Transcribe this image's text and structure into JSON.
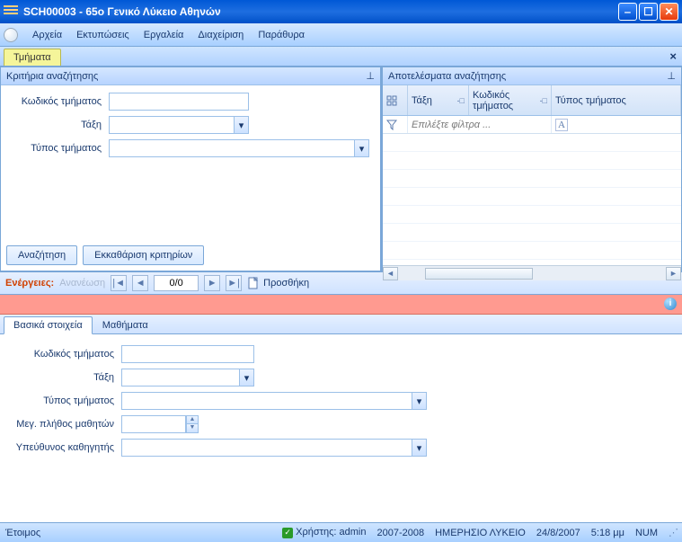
{
  "window": {
    "title": "SCH00003 - 65ο Γενικό Λύκειο Αθηνών"
  },
  "menu": {
    "items": [
      "Αρχεία",
      "Εκτυπώσεις",
      "Εργαλεία",
      "Διαχείριση",
      "Παράθυρα"
    ]
  },
  "main_tab": {
    "label": "Τμήματα"
  },
  "criteria_panel": {
    "title": "Κριτήρια αναζήτησης",
    "fields": {
      "code_label": "Κωδικός τμήματος",
      "class_label": "Τάξη",
      "type_label": "Τύπος τμήματος",
      "code_value": "",
      "class_value": "",
      "type_value": ""
    },
    "search_btn": "Αναζήτηση",
    "clear_btn": "Εκκαθάριση κριτηρίων"
  },
  "results_panel": {
    "title": "Αποτελέσματα αναζήτησης",
    "columns": {
      "col1": "Τάξη",
      "col2": "Κωδικός τμήματος",
      "col3": "Τύπος τμήματος"
    },
    "filter_placeholder": "Επιλέξτε φίλτρα ..."
  },
  "actions": {
    "label": "Ενέργειες:",
    "refresh": "Ανανέωση",
    "pager": "0/0",
    "add": "Προσθήκη"
  },
  "detail_tabs": {
    "basic": "Βασικά στοιχεία",
    "subjects": "Μαθήματα"
  },
  "detail_form": {
    "code_label": "Κωδικός τμήματος",
    "class_label": "Τάξη",
    "type_label": "Τύπος τμήματος",
    "max_label": "Μεγ. πλήθος μαθητών",
    "teacher_label": "Υπεύθυνος καθηγητής",
    "code_value": "",
    "class_value": "",
    "type_value": "",
    "max_value": "",
    "teacher_value": ""
  },
  "statusbar": {
    "ready": "Έτοιμος",
    "user_label": "Χρήστης: admin",
    "year": "2007-2008",
    "school": "ΗΜΕΡΗΣΙΟ ΛΥΚΕΙΟ",
    "date": "24/8/2007",
    "time": "5:18 μμ",
    "num": "NUM"
  }
}
